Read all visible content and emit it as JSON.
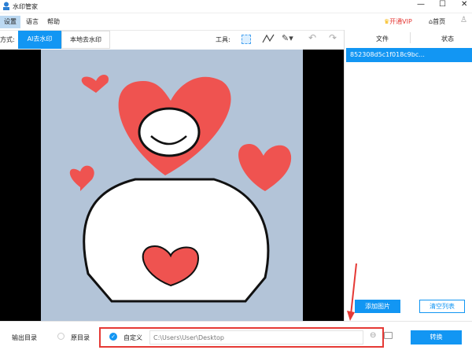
{
  "app": {
    "title": "水印管家"
  },
  "menu": [
    "设置",
    "语言",
    "帮助"
  ],
  "header": {
    "vip": "开通VIP",
    "home": "首页"
  },
  "toolbar": {
    "mode_label": "方式:",
    "modes": [
      "AI去水印",
      "本地去水印"
    ],
    "tools_label": "工具:"
  },
  "filelist": {
    "col_file": "文件",
    "col_status": "状态",
    "items": [
      {
        "name": "852308d5c1f018c9bc..."
      }
    ],
    "add_button": "添加图片",
    "clear_button": "清空列表"
  },
  "output": {
    "label": "输出目录",
    "option_original": "原目录",
    "option_custom": "自定义",
    "path": "C:\\Users\\User\\Desktop",
    "convert_button": "转换"
  },
  "colors": {
    "accent": "#1296f3",
    "highlight": "#e53935"
  }
}
